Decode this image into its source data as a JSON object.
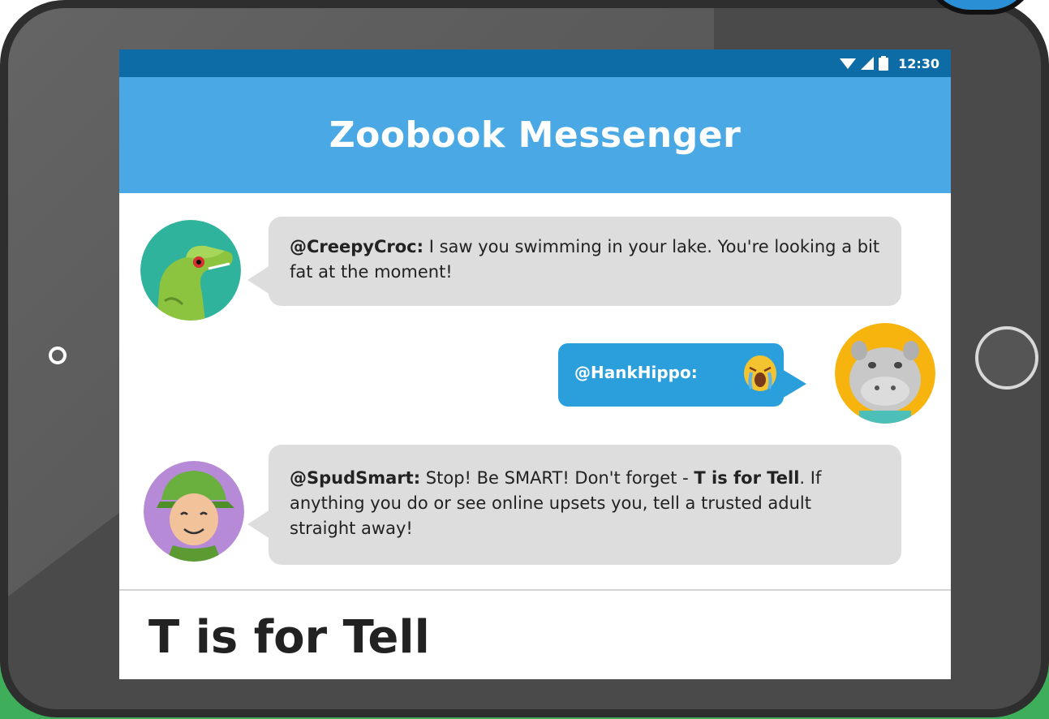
{
  "status_bar": {
    "time": "12:30",
    "icons": [
      "wifi-icon",
      "signal-icon",
      "battery-icon"
    ]
  },
  "app": {
    "title": "Zoobook Messenger"
  },
  "messages": [
    {
      "sender": "@CreepyCroc:",
      "text": " I saw you swimming in your lake. You're looking a bit fat at the moment!",
      "avatar": "crocodile-avatar",
      "side": "left"
    },
    {
      "sender": "@HankHippo:",
      "emoji": "crying-face-emoji",
      "avatar": "hippo-avatar",
      "side": "right"
    },
    {
      "sender": "@SpudSmart:",
      "text_before": " Stop! Be SMART! Don't forget - ",
      "bold": "T is for Tell",
      "text_after": ". If anything you do or see online upsets you, tell a trusted adult straight away!",
      "avatar": "boy-avatar",
      "side": "left"
    }
  ],
  "footer": {
    "title": "T is for Tell"
  },
  "colors": {
    "status_bar": "#0d6ca5",
    "header": "#4aa9e4",
    "bubble_grey": "#dddddd",
    "bubble_blue": "#2a9fdc",
    "tablet": "#4a4a4a",
    "green": "#3fae5a"
  }
}
